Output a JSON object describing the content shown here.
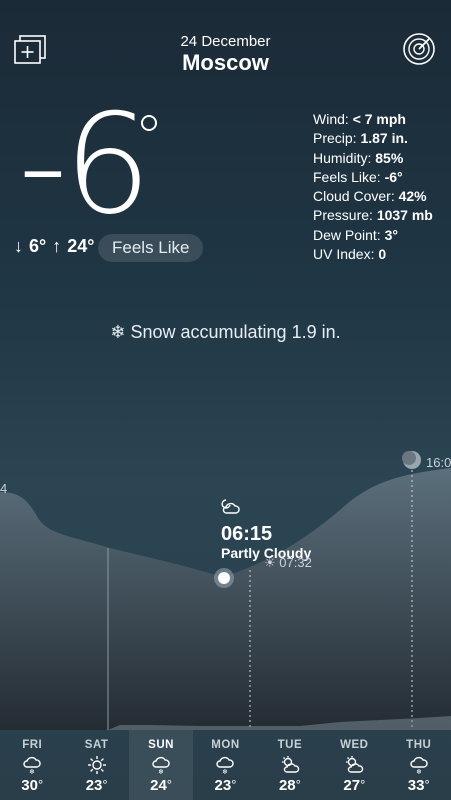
{
  "header": {
    "date": "24 December",
    "city": "Moscow"
  },
  "current": {
    "temp": "-6",
    "low": "6°",
    "high": "24°",
    "feels_like_button": "Feels Like"
  },
  "details": [
    {
      "label": "Wind:",
      "value": "< 7 mph"
    },
    {
      "label": "Precip:",
      "value": "1.87 in."
    },
    {
      "label": "Humidity:",
      "value": "85%"
    },
    {
      "label": "Feels Like:",
      "value": "-6°"
    },
    {
      "label": "Cloud Cover:",
      "value": "42%"
    },
    {
      "label": "Pressure:",
      "value": "1037 mb"
    },
    {
      "label": "Dew Point:",
      "value": "3°"
    },
    {
      "label": "UV Index:",
      "value": "0"
    }
  ],
  "snow_notice": "Snow accumulating 1.9 in.",
  "graph": {
    "now_time": "06:15",
    "now_condition": "Partly Cloudy",
    "sunrise_time": "07:32",
    "sunset_time": "16:0",
    "edge_value": "4",
    "now_icon": "partly-cloudy-night-icon"
  },
  "days": [
    {
      "name": "FRI",
      "temp": "30",
      "icon": "snow-cloud-icon",
      "selected": false
    },
    {
      "name": "SAT",
      "temp": "23",
      "icon": "sun-icon",
      "selected": false
    },
    {
      "name": "SUN",
      "temp": "24",
      "icon": "snow-cloud-icon",
      "selected": true
    },
    {
      "name": "MON",
      "temp": "23",
      "icon": "snow-cloud-icon",
      "selected": false
    },
    {
      "name": "TUE",
      "temp": "28",
      "icon": "partly-cloudy-icon",
      "selected": false
    },
    {
      "name": "WED",
      "temp": "27",
      "icon": "partly-cloudy-icon",
      "selected": false
    },
    {
      "name": "THU",
      "temp": "33",
      "icon": "snow-cloud-icon",
      "selected": false
    }
  ],
  "colors": {
    "background_top": "#1b2a37",
    "background_bottom": "#2a3e4a",
    "graph_fill": "#5b6f7c",
    "accent": "#ffffff"
  }
}
